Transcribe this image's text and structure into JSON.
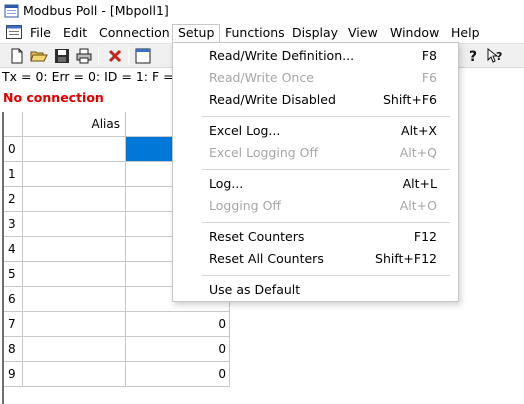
{
  "window": {
    "title": "Modbus Poll - [Mbpoll1]"
  },
  "menubar": {
    "items": [
      {
        "label": "File"
      },
      {
        "label": "Edit"
      },
      {
        "label": "Connection"
      },
      {
        "label": "Setup",
        "active": true
      },
      {
        "label": "Functions"
      },
      {
        "label": "Display"
      },
      {
        "label": "View"
      },
      {
        "label": "Window"
      },
      {
        "label": "Help"
      }
    ]
  },
  "toolbar": {
    "buttons": [
      "new-icon",
      "open-folder-icon",
      "save-icon",
      "print-icon",
      "delete-icon",
      "window-icon",
      "help-icon",
      "context-help-icon"
    ]
  },
  "status": {
    "line": "Tx = 0: Err = 0: ID = 1: F =",
    "connection": "No connection",
    "connection_color": "#e00000"
  },
  "grid": {
    "column_header": "Alias",
    "rows": [
      {
        "index": "0",
        "value": ""
      },
      {
        "index": "1",
        "value": ""
      },
      {
        "index": "2",
        "value": ""
      },
      {
        "index": "3",
        "value": ""
      },
      {
        "index": "4",
        "value": ""
      },
      {
        "index": "5",
        "value": ""
      },
      {
        "index": "6",
        "value": ""
      },
      {
        "index": "7",
        "value": "0"
      },
      {
        "index": "8",
        "value": "0"
      },
      {
        "index": "9",
        "value": "0"
      }
    ],
    "selection_color": "#0078d7"
  },
  "setup_menu": {
    "items": [
      {
        "label": "Read/Write Definition...",
        "shortcut": "F8",
        "enabled": true
      },
      {
        "label": "Read/Write Once",
        "shortcut": "F6",
        "enabled": false
      },
      {
        "label": "Read/Write Disabled",
        "shortcut": "Shift+F6",
        "enabled": true
      },
      {
        "label": "Excel Log...",
        "shortcut": "Alt+X",
        "enabled": true
      },
      {
        "label": "Excel Logging Off",
        "shortcut": "Alt+Q",
        "enabled": false
      },
      {
        "label": "Log...",
        "shortcut": "Alt+L",
        "enabled": true
      },
      {
        "label": "Logging Off",
        "shortcut": "Alt+O",
        "enabled": false
      },
      {
        "label": "Reset Counters",
        "shortcut": "F12",
        "enabled": true
      },
      {
        "label": "Reset All Counters",
        "shortcut": "Shift+F12",
        "enabled": true
      },
      {
        "label": "Use as Default",
        "shortcut": "",
        "enabled": true
      }
    ]
  }
}
